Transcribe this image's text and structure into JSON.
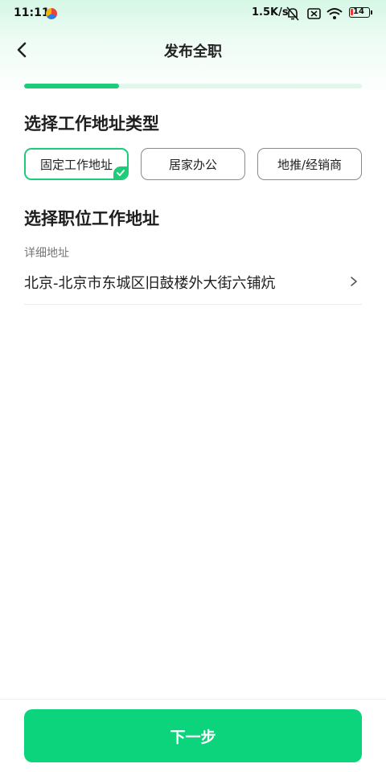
{
  "status_bar": {
    "time": "11:11",
    "network_speed": "1.5K/s",
    "battery_level": "14",
    "battery_percent": 14,
    "icons": [
      "app-icon",
      "mute-bell-icon",
      "no-sim-icon",
      "wifi-icon",
      "battery-icon"
    ]
  },
  "header": {
    "title": "发布全职",
    "back_icon": "chevron-left-icon"
  },
  "progress": {
    "fraction": 0.28,
    "fill_color": "#1ccc78",
    "track_color": "#e1f7ec"
  },
  "work_type_section": {
    "title": "选择工作地址类型",
    "options": [
      {
        "label": "固定工作地址",
        "selected": true
      },
      {
        "label": "居家办公",
        "selected": false
      },
      {
        "label": "地推/经销商",
        "selected": false
      }
    ]
  },
  "address_section": {
    "title": "选择职位工作地址",
    "field_label": "详细地址",
    "value": "北京-北京市东城区旧鼓楼外大街六铺炕",
    "chevron_icon": "chevron-right-icon"
  },
  "footer": {
    "next_label": "下一步",
    "button_color": "#0bd47d"
  }
}
